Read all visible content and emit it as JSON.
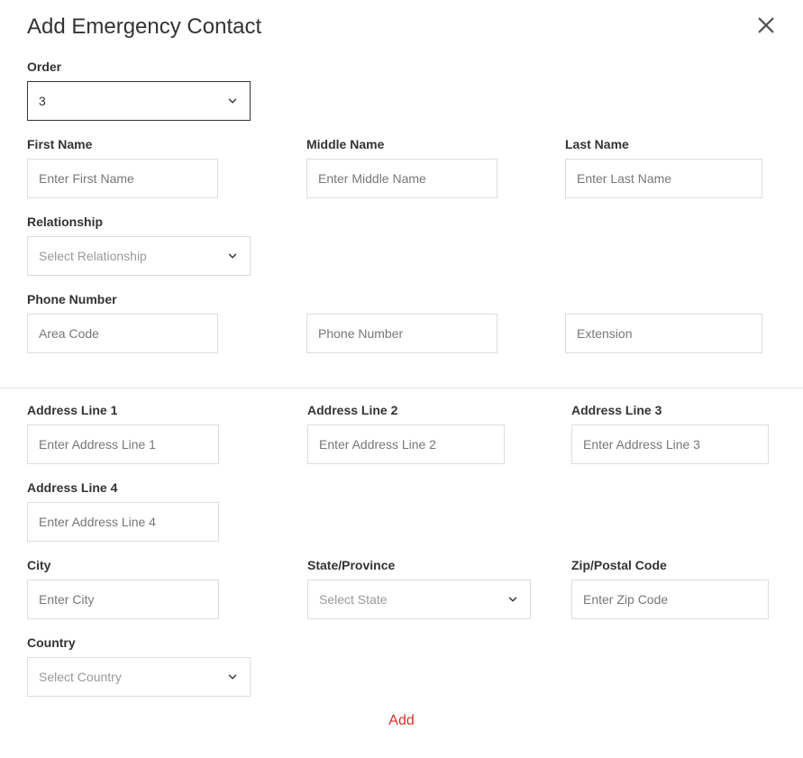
{
  "header": {
    "title": "Add Emergency Contact"
  },
  "labels": {
    "order": "Order",
    "firstName": "First Name",
    "middleName": "Middle Name",
    "lastName": "Last Name",
    "relationship": "Relationship",
    "phoneNumber": "Phone Number",
    "address1": "Address Line 1",
    "address2": "Address Line 2",
    "address3": "Address Line 3",
    "address4": "Address Line 4",
    "city": "City",
    "state": "State/Province",
    "zip": "Zip/Postal Code",
    "country": "Country"
  },
  "values": {
    "order": "3"
  },
  "placeholders": {
    "firstName": "Enter First Name",
    "middleName": "Enter Middle Name",
    "lastName": "Enter Last Name",
    "relationship": "Select Relationship",
    "areaCode": "Area Code",
    "phoneNumber": "Phone Number",
    "extension": "Extension",
    "address1": "Enter Address Line 1",
    "address2": "Enter Address Line 2",
    "address3": "Enter Address Line 3",
    "address4": "Enter Address Line 4",
    "city": "Enter City",
    "state": "Select State",
    "zip": "Enter Zip Code",
    "country": "Select Country"
  },
  "buttons": {
    "add": "Add"
  }
}
